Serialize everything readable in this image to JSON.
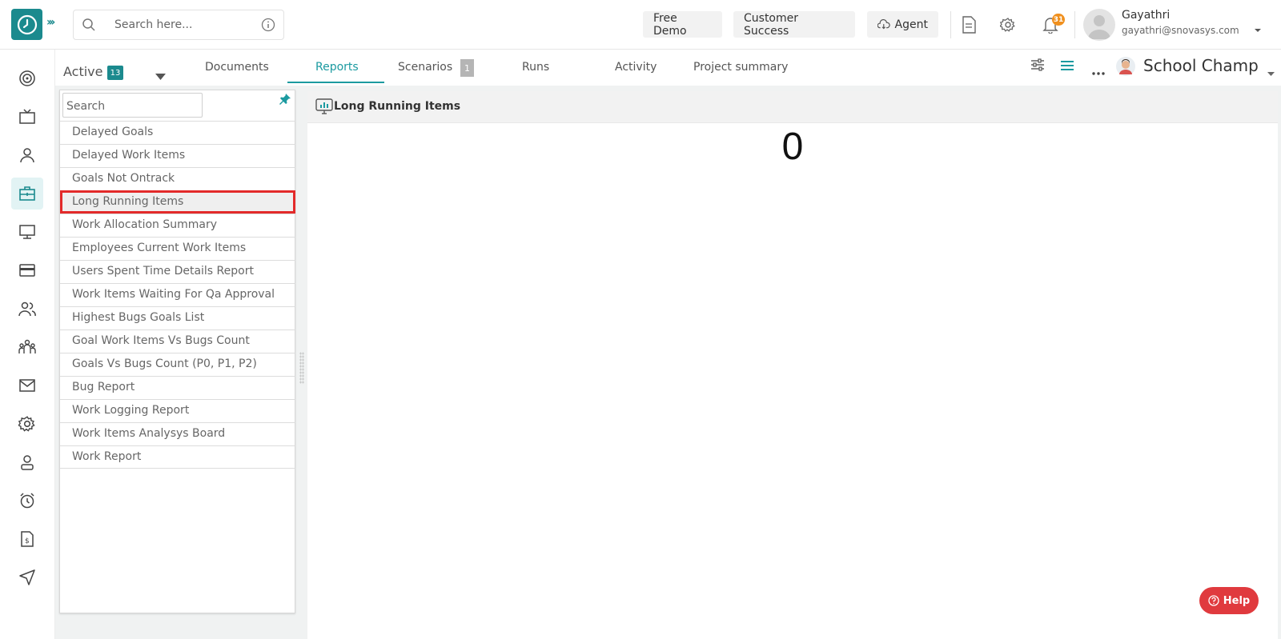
{
  "header": {
    "search_placeholder": "Search here...",
    "free_demo": "Free Demo",
    "customer_success": "Customer Success",
    "agent": "Agent",
    "notifications_count": "31",
    "user_name": "Gayathri",
    "user_email": "gayathri@snovasys.com"
  },
  "subbar": {
    "active_label": "Active",
    "active_count": "13",
    "tabs": [
      {
        "label": "Documents"
      },
      {
        "label": "Reports"
      },
      {
        "label": "Scenarios"
      },
      {
        "label": "Runs"
      },
      {
        "label": "Activity"
      },
      {
        "label": "Project summary"
      }
    ],
    "scenarios_count": "1",
    "project_name": "School Champ"
  },
  "reports": {
    "search_placeholder": "Search",
    "items": [
      "Delayed Goals",
      "Delayed Work Items",
      "Goals Not Ontrack",
      "Long Running Items",
      "Work Allocation Summary",
      "Employees Current Work Items",
      "Users Spent Time Details Report",
      "Work Items Waiting For Qa Approval",
      "Highest Bugs Goals List",
      "Goal Work Items Vs Bugs Count",
      "Goals Vs Bugs Count (P0, P1, P2)",
      "Bug Report",
      "Work Logging Report",
      "Work Items Analysys Board",
      "Work Report"
    ],
    "selected_index": 3
  },
  "report_view": {
    "title": "Long Running Items",
    "value": "0"
  },
  "help_label": "Help",
  "colors": {
    "brand": "#1b8a8e",
    "tab_active": "#1b9aa0",
    "selection_outline": "#e32a2a",
    "help": "#e03a3e",
    "badge": "#f0901e"
  }
}
